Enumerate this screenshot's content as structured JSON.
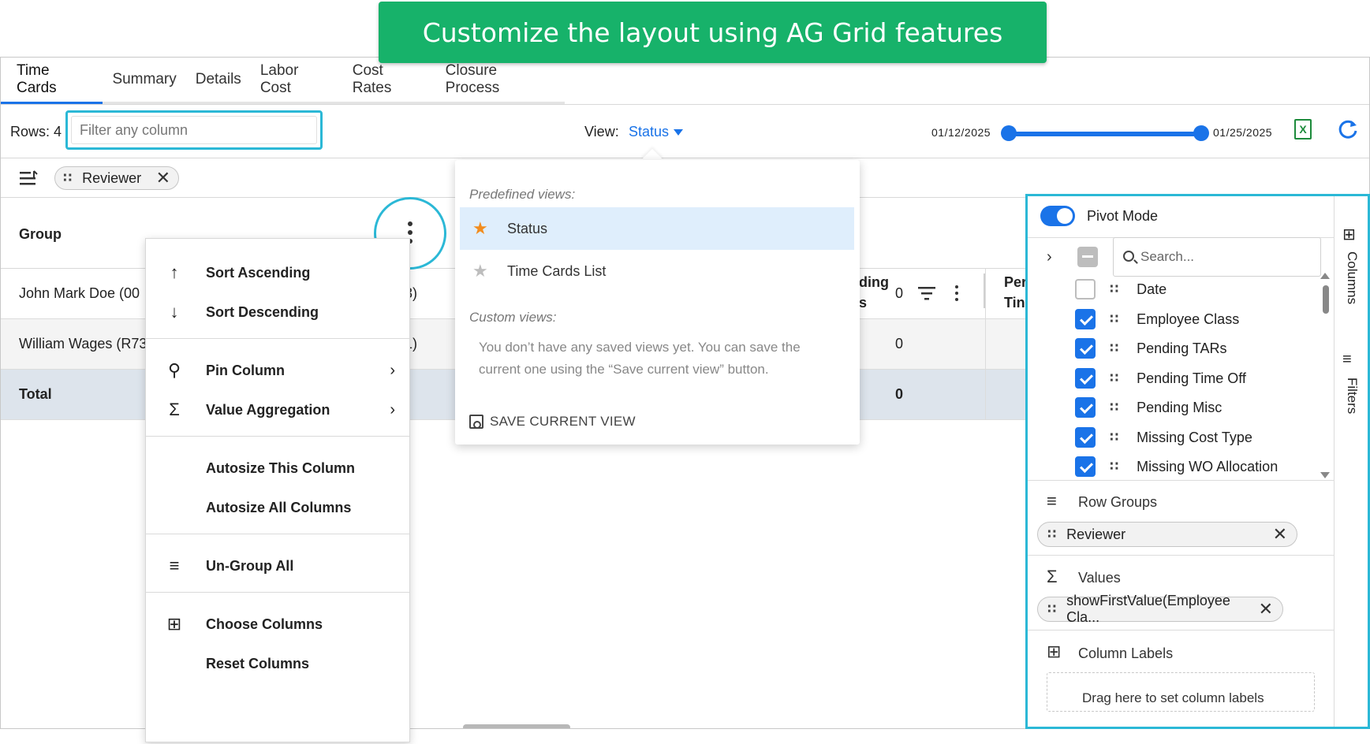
{
  "banner": {
    "text": "Customize the layout using AG Grid features",
    "color": "#17b26a"
  },
  "tabs": [
    {
      "label": "Time Cards",
      "active": true
    },
    {
      "label": "Summary"
    },
    {
      "label": "Details"
    },
    {
      "label": "Labor Cost"
    },
    {
      "label": "Cost Rates"
    },
    {
      "label": "Closure Process"
    }
  ],
  "toolbar": {
    "rows_label": "Rows: 4",
    "filter_placeholder": "Filter any column",
    "view_label": "View:",
    "view_value": "Status",
    "date_start": "01/12/2025",
    "date_end": "01/25/2025",
    "excel_icon": "excel-export-icon",
    "refresh_icon": "refresh-icon"
  },
  "group_bar": {
    "chip_label": "Reviewer"
  },
  "grid": {
    "header_group": "Group",
    "header_partial_1a": "ding",
    "header_partial_1b": "s",
    "header_partial_2a": "Per",
    "header_partial_2b": "Tin",
    "rows": [
      {
        "name": "John Mark Doe (00",
        "frag": "3)",
        "value": "0"
      },
      {
        "name": "William Wages (R73",
        "frag": "1)",
        "value": "0"
      }
    ],
    "total": {
      "name": "Total",
      "value": "0"
    }
  },
  "column_menu": {
    "sort_asc": "Sort Ascending",
    "sort_desc": "Sort Descending",
    "pin_column": "Pin Column",
    "value_aggregation": "Value Aggregation",
    "autosize_this": "Autosize This Column",
    "autosize_all": "Autosize All Columns",
    "ungroup_all": "Un-Group All",
    "choose_columns": "Choose Columns",
    "reset_columns": "Reset Columns"
  },
  "view_dropdown": {
    "predefined_title": "Predefined views:",
    "predefined": [
      {
        "label": "Status",
        "selected": true,
        "star_color": "#f28c1e"
      },
      {
        "label": "Time Cards List",
        "selected": false,
        "star_color": "#bdbdbd"
      }
    ],
    "custom_title": "Custom views:",
    "empty_message": "You don’t have any saved views yet. You can save the current one using the “Save current view” button.",
    "save_label": "SAVE CURRENT VIEW"
  },
  "side_panel": {
    "pivot_label": "Pivot Mode",
    "pivot_on": true,
    "search_placeholder": "Search...",
    "columns": [
      {
        "label": "Date",
        "checked": false
      },
      {
        "label": "Employee Class",
        "checked": true
      },
      {
        "label": "Pending TARs",
        "checked": true
      },
      {
        "label": "Pending Time Off",
        "checked": true
      },
      {
        "label": "Pending Misc",
        "checked": true
      },
      {
        "label": "Missing Cost Type",
        "checked": true
      },
      {
        "label": "Missing WO Allocation",
        "checked": true
      }
    ],
    "row_groups_title": "Row Groups",
    "row_group_chip": "Reviewer",
    "values_title": "Values",
    "values_chip": "showFirstValue(Employee Cla...",
    "column_labels_title": "Column Labels",
    "drop_hint": "Drag here to set column labels",
    "tab_columns": "Columns",
    "tab_filters": "Filters"
  },
  "colors": {
    "accent": "#1a73e8",
    "highlight_ring": "#2bb8d6"
  }
}
